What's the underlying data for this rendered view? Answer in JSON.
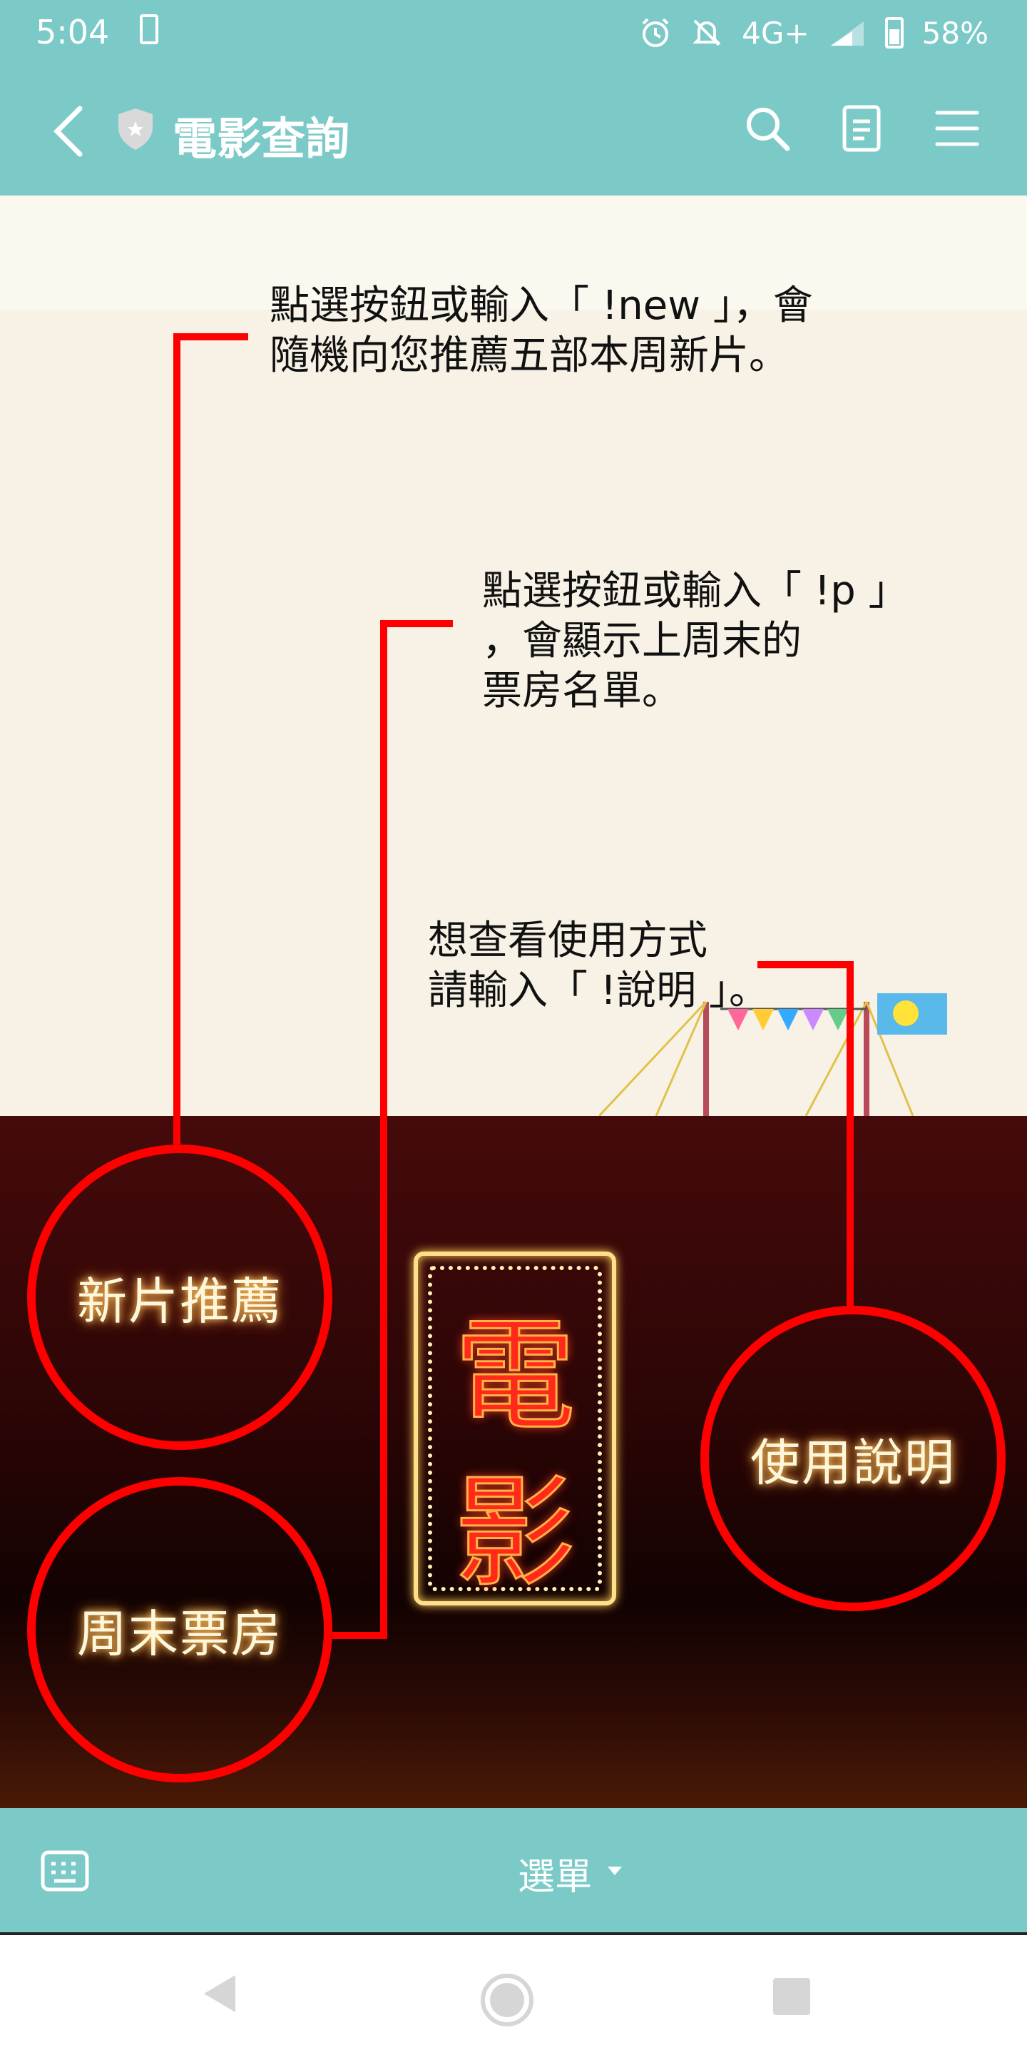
{
  "status_bar": {
    "time": "5:04",
    "network": "4G+",
    "battery": "58%",
    "icons": [
      "sim-icon",
      "alarm-icon",
      "mute-icon",
      "signal-icon",
      "battery-icon"
    ]
  },
  "header": {
    "title": "電影查詢",
    "icons": [
      "back-icon",
      "shield-icon",
      "search-icon",
      "notes-icon",
      "menu-icon"
    ]
  },
  "rich_menu": {
    "notes": {
      "new": "點選按鈕或輸入「 !new 」，會\n隨機向您推薦五部本周新片。",
      "boxoffice": "點選按鈕或輸入「 !p 」\n，會顯示上周末的\n票房名單。",
      "help": "想查看使用方式\n請輸入「 !說明 」。"
    },
    "buttons": {
      "new": "新片推薦",
      "boxoffice": "周末票房",
      "help": "使用說明"
    },
    "marquee": [
      "電",
      "影"
    ]
  },
  "bottom_bar": {
    "menu_label": "選單",
    "icons": [
      "keyboard-icon",
      "caret-down-icon"
    ]
  },
  "nav_bar": {
    "icons": [
      "nav-back-icon",
      "nav-home-icon",
      "nav-recents-icon"
    ]
  },
  "colors": {
    "accent": "#7ccac8",
    "annotation": "#ff0000",
    "background": "#f8f2e6",
    "dark_panel": "#2a0505"
  }
}
